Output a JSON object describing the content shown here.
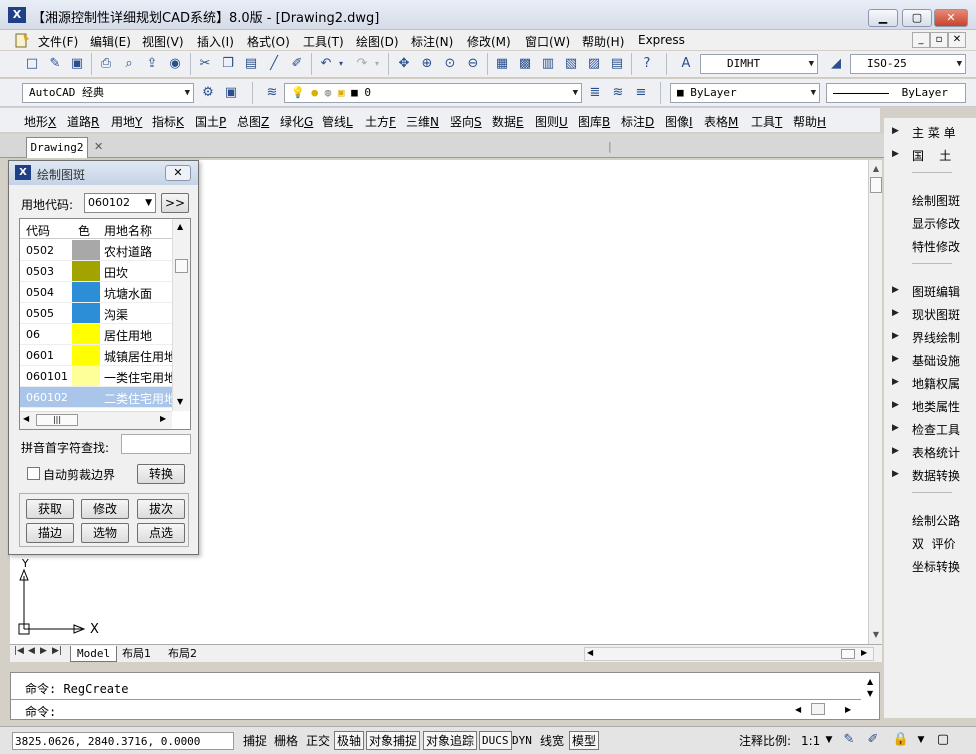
{
  "window": {
    "title": "【湘源控制性详细规划CAD系统】8.0版 - [Drawing2.dwg]",
    "minimize": "▁",
    "maximize": "▢",
    "close": "✕"
  },
  "menubar": {
    "items": [
      "文件(F)",
      "编辑(E)",
      "视图(V)",
      "插入(I)",
      "格式(O)",
      "工具(T)",
      "绘图(D)",
      "标注(N)",
      "修改(M)",
      "窗口(W)",
      "帮助(H)",
      "Express"
    ],
    "mdi_minimize": "_",
    "mdi_restore": "▫",
    "mdi_close": "✕"
  },
  "toolbar1": {
    "dim_style": "DIMHT",
    "text_style": "ISO-25"
  },
  "toolbar2": {
    "workspace": "AutoCAD 经典",
    "layer": "0",
    "color": "ByLayer",
    "linetype": "ByLayer"
  },
  "commands": [
    {
      "text": "地形",
      "key": "X"
    },
    {
      "text": "道路",
      "key": "R"
    },
    {
      "text": "用地",
      "key": "Y"
    },
    {
      "text": "指标",
      "key": "K"
    },
    {
      "text": "国土",
      "key": "P"
    },
    {
      "text": "总图",
      "key": "Z"
    },
    {
      "text": "绿化",
      "key": "G"
    },
    {
      "text": "管线",
      "key": "L"
    },
    {
      "text": "土方",
      "key": "F"
    },
    {
      "text": "三维",
      "key": "N"
    },
    {
      "text": "竖向",
      "key": "S"
    },
    {
      "text": "数据",
      "key": "E"
    },
    {
      "text": "图则",
      "key": "U"
    },
    {
      "text": "图库",
      "key": "B"
    },
    {
      "text": "标注",
      "key": "D"
    },
    {
      "text": "图像",
      "key": "I"
    },
    {
      "text": "表格",
      "key": "M"
    },
    {
      "text": "工具",
      "key": "T"
    },
    {
      "text": "帮助",
      "key": "H"
    }
  ],
  "doc_tab": "Drawing2",
  "layout_tabs": [
    "Model",
    "布局1",
    "布局2"
  ],
  "ucs": {
    "x": "X",
    "y": "Y"
  },
  "command_window": {
    "history": "命令: RegCreate",
    "prompt": "命令:"
  },
  "statusbar": {
    "coords": "3825.0626, 2840.3716, 0.0000",
    "toggles": [
      {
        "label": "捕捉",
        "on": false
      },
      {
        "label": "栅格",
        "on": false
      },
      {
        "label": "正交",
        "on": false
      },
      {
        "label": "极轴",
        "on": true
      },
      {
        "label": "对象捕捉",
        "on": true
      },
      {
        "label": "对象追踪",
        "on": true
      },
      {
        "label": "DUCS",
        "on": true
      },
      {
        "label": "DYN",
        "on": false
      },
      {
        "label": "线宽",
        "on": false
      },
      {
        "label": "模型",
        "on": true
      }
    ],
    "annotation_scale_label": "注释比例:",
    "annotation_scale": "1:1"
  },
  "right_panel": {
    "groups": [
      {
        "items": [
          {
            "label": "主 菜 单",
            "arrow": true
          },
          {
            "label": "国    土",
            "arrow": true
          }
        ]
      },
      {
        "items": [
          {
            "label": "绘制图斑",
            "arrow": false
          },
          {
            "label": "显示修改",
            "arrow": false
          },
          {
            "label": "特性修改",
            "arrow": false
          }
        ]
      },
      {
        "items": [
          {
            "label": "图斑编辑",
            "arrow": true
          },
          {
            "label": "现状图斑",
            "arrow": true
          },
          {
            "label": "界线绘制",
            "arrow": true
          },
          {
            "label": "基础设施",
            "arrow": true
          },
          {
            "label": "地籍权属",
            "arrow": true
          },
          {
            "label": "地类属性",
            "arrow": true
          },
          {
            "label": "检查工具",
            "arrow": true
          },
          {
            "label": "表格统计",
            "arrow": true
          },
          {
            "label": "数据转换",
            "arrow": true
          }
        ]
      },
      {
        "items": [
          {
            "label": "绘制公路",
            "arrow": false
          },
          {
            "label": "双  评价",
            "arrow": false
          },
          {
            "label": "坐标转换",
            "arrow": false
          }
        ]
      }
    ]
  },
  "dialog": {
    "title": "绘制图斑",
    "land_code_label": "用地代码:",
    "land_code_value": "060102",
    "expand_button": ">>",
    "columns": [
      "代码",
      "色",
      "用地名称"
    ],
    "rows": [
      {
        "code": "0502",
        "color": "#a8a8a8",
        "name": "农村道路"
      },
      {
        "code": "0503",
        "color": "#a3a300",
        "name": "田坎"
      },
      {
        "code": "0504",
        "color": "#2b8ed6",
        "name": "坑塘水面"
      },
      {
        "code": "0505",
        "color": "#2b8ed6",
        "name": "沟渠"
      },
      {
        "code": "06",
        "color": "#ffff00",
        "name": "居住用地"
      },
      {
        "code": "0601",
        "color": "#ffff00",
        "name": "城镇居住用地"
      },
      {
        "code": "060101",
        "color": "#ffff99",
        "name": "一类住宅用地"
      },
      {
        "code": "060102",
        "color": "#a9c6ea",
        "name": "二类住宅用地",
        "selected": true
      }
    ],
    "pinyin_label": "拼音首字符查找:",
    "pinyin_value": "",
    "auto_clip_label": "自动剪裁边界",
    "auto_clip_checked": false,
    "convert_button": "转换",
    "buttons": [
      "获取",
      "修改",
      "拔次",
      "描边",
      "选物",
      "点选"
    ]
  },
  "colors": {
    "canvas": "#ffffff",
    "selection": "#a9c6ea",
    "title_gradient_top": "#e9eef6"
  }
}
